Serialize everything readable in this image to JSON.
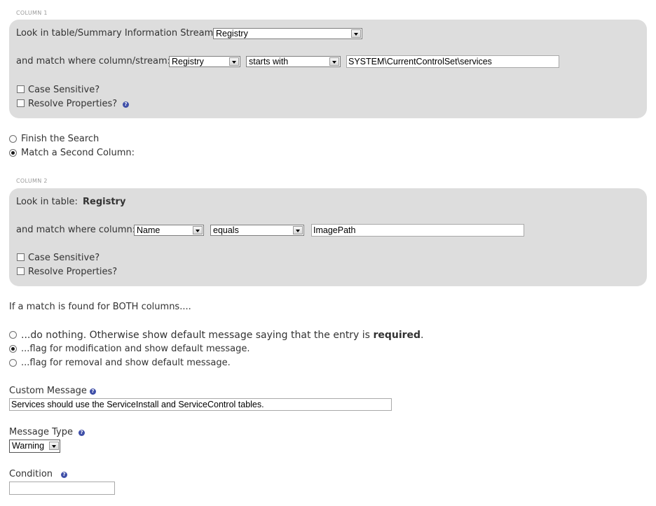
{
  "column1": {
    "caption": "COLUMN 1",
    "look_in_label": "Look in table/Summary Information Stream:",
    "table_value": "Registry",
    "match_label": "and match where column/stream:",
    "column_value": "Registry",
    "operator_value": "starts with",
    "match_text": "SYSTEM\\CurrentControlSet\\services",
    "case_sensitive_label": "Case Sensitive?",
    "case_sensitive_checked": false,
    "resolve_label": "Resolve Properties?",
    "resolve_checked": false,
    "help_icon": "question-mark"
  },
  "next_step": {
    "options": [
      {
        "label": "Finish the Search",
        "selected": false
      },
      {
        "label": "Match a Second Column:",
        "selected": true
      }
    ]
  },
  "column2": {
    "caption": "COLUMN 2",
    "look_in_label": "Look in table:",
    "table_name": "Registry",
    "match_label": "and match where column:",
    "column_value": "Name",
    "operator_value": "equals",
    "match_text": "ImagePath",
    "case_sensitive_label": "Case Sensitive?",
    "case_sensitive_checked": false,
    "resolve_label": "Resolve Properties?",
    "resolve_checked": false
  },
  "actions": {
    "heading": "If a match is found for BOTH columns....",
    "options": [
      {
        "label_prefix": "...do nothing. Otherwise show default message saying that the entry is ",
        "label_bold": "required",
        "label_suffix": ".",
        "selected": false
      },
      {
        "label": "...flag for modification and show default message.",
        "selected": true
      },
      {
        "label": "...flag for removal and show default message.",
        "selected": false
      }
    ]
  },
  "custom_message": {
    "label": "Custom Message",
    "value": "Services should use the ServiceInstall and ServiceControl tables."
  },
  "message_type": {
    "label": "Message Type",
    "value": "Warning"
  },
  "condition": {
    "label": "Condition",
    "value": ""
  },
  "colors": {
    "panel_background": "#dddddd",
    "help_icon": "#3f4fa8",
    "caption_text": "#9a9a9a"
  }
}
